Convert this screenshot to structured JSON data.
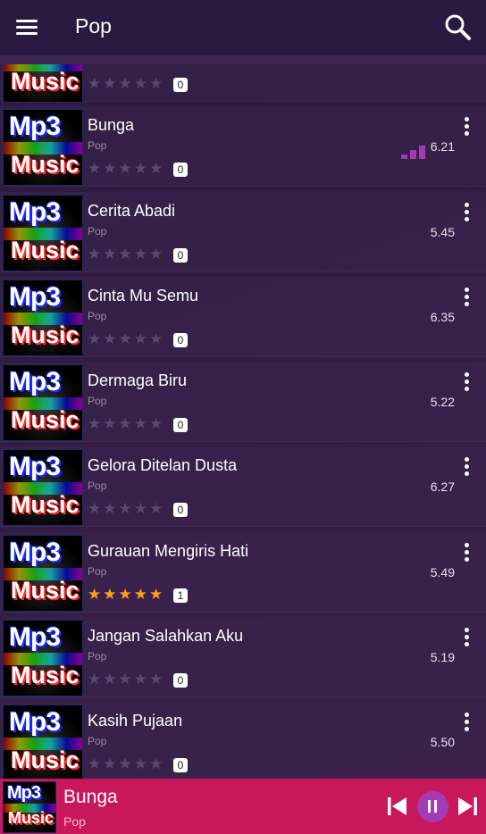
{
  "header": {
    "title": "Pop"
  },
  "partial_row": {
    "rating_count": "0",
    "stars_on": 0
  },
  "songs": [
    {
      "title": "Bunga",
      "genre": "Pop",
      "size": "6.21",
      "rating_count": "0",
      "stars_on": 0,
      "playing": true
    },
    {
      "title": "Cerita Abadi",
      "genre": "Pop",
      "size": "5.45",
      "rating_count": "0",
      "stars_on": 0,
      "playing": false
    },
    {
      "title": "Cinta Mu Semu",
      "genre": "Pop",
      "size": "6.35",
      "rating_count": "0",
      "stars_on": 0,
      "playing": false
    },
    {
      "title": "Dermaga Biru",
      "genre": "Pop",
      "size": "5.22",
      "rating_count": "0",
      "stars_on": 0,
      "playing": false
    },
    {
      "title": "Gelora Ditelan Dusta",
      "genre": "Pop",
      "size": "6.27",
      "rating_count": "0",
      "stars_on": 0,
      "playing": false
    },
    {
      "title": "Gurauan Mengiris Hati",
      "genre": "Pop",
      "size": "5.49",
      "rating_count": "1",
      "stars_on": 5,
      "playing": false
    },
    {
      "title": "Jangan Salahkan Aku",
      "genre": "Pop",
      "size": "5.19",
      "rating_count": "0",
      "stars_on": 0,
      "playing": false
    },
    {
      "title": "Kasih Pujaan",
      "genre": "Pop",
      "size": "5.50",
      "rating_count": "0",
      "stars_on": 0,
      "playing": false
    }
  ],
  "thumbnail": {
    "line1": "Mp3",
    "line2": "Music"
  },
  "player": {
    "title": "Bunga",
    "genre": "Pop"
  },
  "colors": {
    "player_bg": "#c9175c",
    "accent_purple": "#a33bb5",
    "star_on": "#ff9f1a"
  },
  "icons": {
    "menu": "hamburger-icon",
    "search": "search-icon",
    "more": "kebab-menu-icon",
    "prev": "skip-previous-icon",
    "pause": "pause-icon",
    "next": "skip-next-icon"
  }
}
